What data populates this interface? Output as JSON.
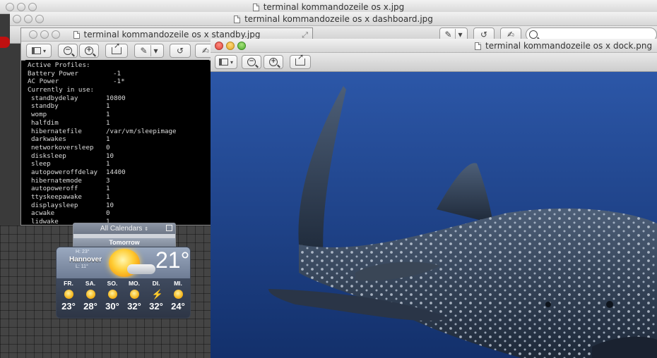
{
  "windows": {
    "back": {
      "title": "terminal kommandozeile os x.jpg"
    },
    "dashboard": {
      "title": "terminal kommandozeile os x dashboard.jpg"
    },
    "standby": {
      "title": "terminal kommandozeile os x standby.jpg"
    },
    "dock": {
      "title": "terminal kommandozeile os x dock.png"
    }
  },
  "terminal": {
    "lines": [
      "Active Profiles:",
      {
        "k": "Battery Power",
        "v": "-1",
        "h": true
      },
      {
        "k": "AC Power",
        "v": "-1*",
        "h": true
      },
      "Currently in use:",
      {
        "k": "standbydelay",
        "v": "10800"
      },
      {
        "k": "standby",
        "v": "1"
      },
      {
        "k": "womp",
        "v": "1"
      },
      {
        "k": "halfdim",
        "v": "1"
      },
      {
        "k": "hibernatefile",
        "v": "/var/vm/sleepimage"
      },
      {
        "k": "darkwakes",
        "v": "1"
      },
      {
        "k": "networkoversleep",
        "v": "0"
      },
      {
        "k": "disksleep",
        "v": "10"
      },
      {
        "k": "sleep",
        "v": "1"
      },
      {
        "k": "autopoweroffdelay",
        "v": "14400"
      },
      {
        "k": "hibernatemode",
        "v": "3"
      },
      {
        "k": "autopoweroff",
        "v": "1"
      },
      {
        "k": "ttyskeepawake",
        "v": "1"
      },
      {
        "k": "displaysleep",
        "v": "10"
      },
      {
        "k": "acwake",
        "v": "0"
      },
      {
        "k": "lidwake",
        "v": "1"
      }
    ]
  },
  "calendar": {
    "header": "All Calendars",
    "sub": "Tomorrow"
  },
  "weather": {
    "city": "Hannover",
    "high": "H: 23°",
    "low": "L: 11°",
    "temp": "21°",
    "forecast": [
      {
        "day": "FR.",
        "temp": "23°",
        "icon": "sun-icon"
      },
      {
        "day": "SA.",
        "temp": "28°",
        "icon": "sun-icon"
      },
      {
        "day": "SO.",
        "temp": "30°",
        "icon": "sun-cloud-icon"
      },
      {
        "day": "MO.",
        "temp": "32°",
        "icon": "sun-cloud-icon"
      },
      {
        "day": "DI.",
        "temp": "32°",
        "icon": "storm-icon"
      },
      {
        "day": "MI.",
        "temp": "24°",
        "icon": "sun-cloud-icon"
      }
    ]
  },
  "colors": {
    "ocean_top": "#2a4f9e",
    "ocean_bottom": "#14306c"
  }
}
